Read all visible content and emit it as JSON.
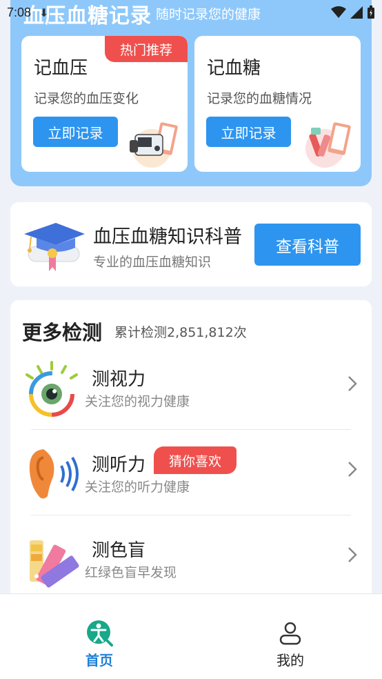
{
  "status": {
    "time": "7:08"
  },
  "header": {
    "title": "血压血糖记录",
    "subtitle": "随时记录您的健康"
  },
  "record_cards": [
    {
      "title": "记血压",
      "desc": "记录您的血压变化",
      "button": "立即记录",
      "badge": "热门推荐",
      "illustration": "blood-pressure-monitor-icon"
    },
    {
      "title": "记血糖",
      "desc": "记录您的血糖情况",
      "button": "立即记录",
      "illustration": "blood-sugar-test-icon"
    }
  ],
  "knowledge": {
    "title": "血压血糖知识科普",
    "subtitle": "专业的血压血糖知识",
    "button": "查看科普",
    "icon": "graduation-cap-icon"
  },
  "more_tests": {
    "title": "更多检测",
    "count": "累计检测2,851,812次",
    "items": [
      {
        "name": "测视力",
        "desc": "关注您的视力健康",
        "icon": "eye-icon"
      },
      {
        "name": "测听力",
        "desc": "关注您的听力健康",
        "badge": "猜你喜欢",
        "icon": "ear-icon"
      },
      {
        "name": "测色盲",
        "desc": "红绿色盲早发现",
        "icon": "color-palette-icon"
      }
    ]
  },
  "bottom_nav": [
    {
      "label": "首页",
      "icon": "home-person-icon",
      "active": true
    },
    {
      "label": "我的",
      "icon": "user-icon",
      "active": false
    }
  ],
  "colors": {
    "primary": "#2d95ef",
    "header_bg": "#8ec8fb",
    "badge_red": "#f0504d",
    "active_nav": "#1e7fd9"
  }
}
